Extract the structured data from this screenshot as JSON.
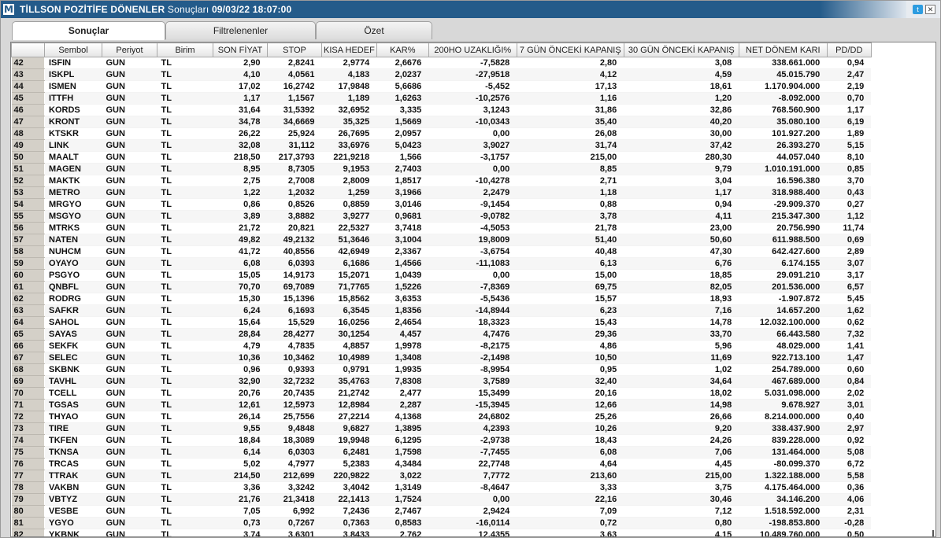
{
  "window": {
    "logo": "M",
    "title": "TİLLSON POZİTİFE DÖNENLER",
    "subtitle": "Sonuçları",
    "datetime": "09/03/22 18:07:00"
  },
  "tabs": [
    {
      "label": "Sonuçlar",
      "active": true
    },
    {
      "label": "Filtrelenenler",
      "active": false
    },
    {
      "label": "Özet",
      "active": false
    }
  ],
  "columns": [
    "",
    "Sembol",
    "Periyot",
    "Birim",
    "SON FİYAT",
    "STOP",
    "KISA HEDEF",
    "KAR%",
    "200HO UZAKLIĞI%",
    "7 GÜN ÖNCEKİ KAPANIŞ",
    "30 GÜN ÖNCEKİ KAPANIŞ",
    "NET DÖNEM KARI",
    "PD/DD"
  ],
  "rows": [
    [
      "42",
      "ISFIN",
      "GUN",
      "TL",
      "2,90",
      "2,8241",
      "2,9774",
      "2,6676",
      "-7,5828",
      "2,80",
      "3,08",
      "338.661.000",
      "0,94"
    ],
    [
      "43",
      "ISKPL",
      "GUN",
      "TL",
      "4,10",
      "4,0561",
      "4,183",
      "2,0237",
      "-27,9518",
      "4,12",
      "4,59",
      "45.015.790",
      "2,47"
    ],
    [
      "44",
      "ISMEN",
      "GUN",
      "TL",
      "17,02",
      "16,2742",
      "17,9848",
      "5,6686",
      "-5,452",
      "17,13",
      "18,61",
      "1.170.904.000",
      "2,19"
    ],
    [
      "45",
      "ITTFH",
      "GUN",
      "TL",
      "1,17",
      "1,1567",
      "1,189",
      "1,6263",
      "-10,2576",
      "1,16",
      "1,20",
      "-8.092.000",
      "0,70"
    ],
    [
      "46",
      "KORDS",
      "GUN",
      "TL",
      "31,64",
      "31,5392",
      "32,6952",
      "3,335",
      "3,1243",
      "31,86",
      "32,86",
      "768.560.900",
      "1,17"
    ],
    [
      "47",
      "KRONT",
      "GUN",
      "TL",
      "34,78",
      "34,6669",
      "35,325",
      "1,5669",
      "-10,0343",
      "35,40",
      "40,20",
      "35.080.100",
      "6,19"
    ],
    [
      "48",
      "KTSKR",
      "GUN",
      "TL",
      "26,22",
      "25,924",
      "26,7695",
      "2,0957",
      "0,00",
      "26,08",
      "30,00",
      "101.927.200",
      "1,89"
    ],
    [
      "49",
      "LINK",
      "GUN",
      "TL",
      "32,08",
      "31,112",
      "33,6976",
      "5,0423",
      "3,9027",
      "31,74",
      "37,42",
      "26.393.270",
      "5,15"
    ],
    [
      "50",
      "MAALT",
      "GUN",
      "TL",
      "218,50",
      "217,3793",
      "221,9218",
      "1,566",
      "-3,1757",
      "215,00",
      "280,30",
      "44.057.040",
      "8,10"
    ],
    [
      "51",
      "MAGEN",
      "GUN",
      "TL",
      "8,95",
      "8,7305",
      "9,1953",
      "2,7403",
      "0,00",
      "8,85",
      "9,79",
      "1.010.191.000",
      "0,85"
    ],
    [
      "52",
      "MAKTK",
      "GUN",
      "TL",
      "2,75",
      "2,7008",
      "2,8009",
      "1,8517",
      "-10,4278",
      "2,71",
      "3,04",
      "16.596.380",
      "3,70"
    ],
    [
      "53",
      "METRO",
      "GUN",
      "TL",
      "1,22",
      "1,2032",
      "1,259",
      "3,1966",
      "2,2479",
      "1,18",
      "1,17",
      "318.988.400",
      "0,43"
    ],
    [
      "54",
      "MRGYO",
      "GUN",
      "TL",
      "0,86",
      "0,8526",
      "0,8859",
      "3,0146",
      "-9,1454",
      "0,88",
      "0,94",
      "-29.909.370",
      "0,27"
    ],
    [
      "55",
      "MSGYO",
      "GUN",
      "TL",
      "3,89",
      "3,8882",
      "3,9277",
      "0,9681",
      "-9,0782",
      "3,78",
      "4,11",
      "215.347.300",
      "1,12"
    ],
    [
      "56",
      "MTRKS",
      "GUN",
      "TL",
      "21,72",
      "20,821",
      "22,5327",
      "3,7418",
      "-4,5053",
      "21,78",
      "23,00",
      "20.756.990",
      "11,74"
    ],
    [
      "57",
      "NATEN",
      "GUN",
      "TL",
      "49,82",
      "49,2132",
      "51,3646",
      "3,1004",
      "19,8009",
      "51,40",
      "50,60",
      "611.988.500",
      "0,69"
    ],
    [
      "58",
      "NUHCM",
      "GUN",
      "TL",
      "41,72",
      "40,8556",
      "42,6949",
      "2,3367",
      "-3,6754",
      "40,48",
      "47,30",
      "642.427.600",
      "2,89"
    ],
    [
      "59",
      "OYAYO",
      "GUN",
      "TL",
      "6,08",
      "6,0393",
      "6,1686",
      "1,4566",
      "-11,1083",
      "6,13",
      "6,76",
      "6.174.155",
      "3,07"
    ],
    [
      "60",
      "PSGYO",
      "GUN",
      "TL",
      "15,05",
      "14,9173",
      "15,2071",
      "1,0439",
      "0,00",
      "15,00",
      "18,85",
      "29.091.210",
      "3,17"
    ],
    [
      "61",
      "QNBFL",
      "GUN",
      "TL",
      "70,70",
      "69,7089",
      "71,7765",
      "1,5226",
      "-7,8369",
      "69,75",
      "82,05",
      "201.536.000",
      "6,57"
    ],
    [
      "62",
      "RODRG",
      "GUN",
      "TL",
      "15,30",
      "15,1396",
      "15,8562",
      "3,6353",
      "-5,5436",
      "15,57",
      "18,93",
      "-1.907.872",
      "5,45"
    ],
    [
      "63",
      "SAFKR",
      "GUN",
      "TL",
      "6,24",
      "6,1693",
      "6,3545",
      "1,8356",
      "-14,8944",
      "6,23",
      "7,16",
      "14.657.200",
      "1,62"
    ],
    [
      "64",
      "SAHOL",
      "GUN",
      "TL",
      "15,64",
      "15,529",
      "16,0256",
      "2,4654",
      "18,3323",
      "15,43",
      "14,78",
      "12.032.100.000",
      "0,62"
    ],
    [
      "65",
      "SAYAS",
      "GUN",
      "TL",
      "28,84",
      "28,4277",
      "30,1254",
      "4,457",
      "4,7476",
      "29,36",
      "33,70",
      "66.443.580",
      "7,32"
    ],
    [
      "66",
      "SEKFK",
      "GUN",
      "TL",
      "4,79",
      "4,7835",
      "4,8857",
      "1,9978",
      "-8,2175",
      "4,86",
      "5,96",
      "48.029.000",
      "1,41"
    ],
    [
      "67",
      "SELEC",
      "GUN",
      "TL",
      "10,36",
      "10,3462",
      "10,4989",
      "1,3408",
      "-2,1498",
      "10,50",
      "11,69",
      "922.713.100",
      "1,47"
    ],
    [
      "68",
      "SKBNK",
      "GUN",
      "TL",
      "0,96",
      "0,9393",
      "0,9791",
      "1,9935",
      "-8,9954",
      "0,95",
      "1,02",
      "254.789.000",
      "0,60"
    ],
    [
      "69",
      "TAVHL",
      "GUN",
      "TL",
      "32,90",
      "32,7232",
      "35,4763",
      "7,8308",
      "3,7589",
      "32,40",
      "34,64",
      "467.689.000",
      "0,84"
    ],
    [
      "70",
      "TCELL",
      "GUN",
      "TL",
      "20,76",
      "20,7435",
      "21,2742",
      "2,477",
      "15,3499",
      "20,16",
      "18,02",
      "5.031.098.000",
      "2,02"
    ],
    [
      "71",
      "TGSAS",
      "GUN",
      "TL",
      "12,61",
      "12,5973",
      "12,8984",
      "2,287",
      "-15,3945",
      "12,66",
      "14,98",
      "9.678.927",
      "3,01"
    ],
    [
      "72",
      "THYAO",
      "GUN",
      "TL",
      "26,14",
      "25,7556",
      "27,2214",
      "4,1368",
      "24,6802",
      "25,26",
      "26,66",
      "8.214.000.000",
      "0,40"
    ],
    [
      "73",
      "TIRE",
      "GUN",
      "TL",
      "9,55",
      "9,4848",
      "9,6827",
      "1,3895",
      "4,2393",
      "10,26",
      "9,20",
      "338.437.900",
      "2,97"
    ],
    [
      "74",
      "TKFEN",
      "GUN",
      "TL",
      "18,84",
      "18,3089",
      "19,9948",
      "6,1295",
      "-2,9738",
      "18,43",
      "24,26",
      "839.228.000",
      "0,92"
    ],
    [
      "75",
      "TKNSA",
      "GUN",
      "TL",
      "6,14",
      "6,0303",
      "6,2481",
      "1,7598",
      "-7,7455",
      "6,08",
      "7,06",
      "131.464.000",
      "5,08"
    ],
    [
      "76",
      "TRCAS",
      "GUN",
      "TL",
      "5,02",
      "4,7977",
      "5,2383",
      "4,3484",
      "22,7748",
      "4,64",
      "4,45",
      "-80.099.370",
      "6,72"
    ],
    [
      "77",
      "TTRAK",
      "GUN",
      "TL",
      "214,50",
      "212,699",
      "220,9822",
      "3,022",
      "7,7772",
      "213,60",
      "215,00",
      "1.322.188.000",
      "5,58"
    ],
    [
      "78",
      "VAKBN",
      "GUN",
      "TL",
      "3,36",
      "3,3242",
      "3,4042",
      "1,3149",
      "-8,4647",
      "3,33",
      "3,75",
      "4.175.464.000",
      "0,36"
    ],
    [
      "79",
      "VBTYZ",
      "GUN",
      "TL",
      "21,76",
      "21,3418",
      "22,1413",
      "1,7524",
      "0,00",
      "22,16",
      "30,46",
      "34.146.200",
      "4,06"
    ],
    [
      "80",
      "VESBE",
      "GUN",
      "TL",
      "7,05",
      "6,992",
      "7,2436",
      "2,7467",
      "2,9424",
      "7,09",
      "7,12",
      "1.518.592.000",
      "2,31"
    ],
    [
      "81",
      "YGYO",
      "GUN",
      "TL",
      "0,73",
      "0,7267",
      "0,7363",
      "0,8583",
      "-16,0114",
      "0,72",
      "0,80",
      "-198.853.800",
      "-0,28"
    ],
    [
      "82",
      "YKBNK",
      "GUN",
      "TL",
      "3,74",
      "3,6301",
      "3,8433",
      "2,762",
      "12,4355",
      "3,63",
      "4,15",
      "10.489.760.000",
      "0,50"
    ]
  ]
}
